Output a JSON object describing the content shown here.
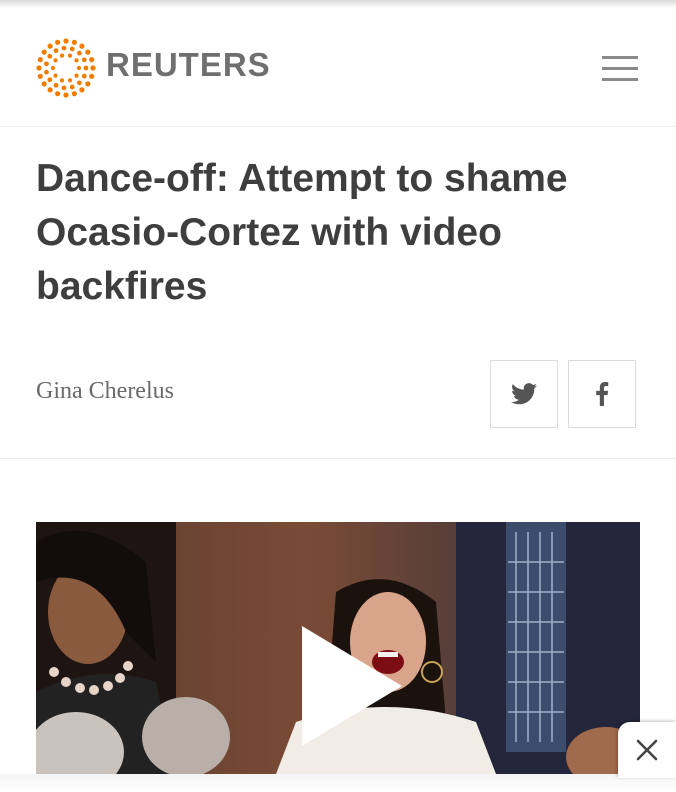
{
  "header": {
    "brand": "REUTERS",
    "brand_color": "#f07d00",
    "logo_icon": "reuters-dot-logo",
    "menu_icon": "hamburger-menu-icon"
  },
  "article": {
    "headline": "Dance-off: Attempt to shame Ocasio-Cortez with video backfires",
    "author": "Gina Cherelus"
  },
  "share": {
    "twitter_icon": "twitter-bird-icon",
    "facebook_icon": "facebook-f-icon"
  },
  "video": {
    "play_icon": "play-icon"
  },
  "ad": {
    "close_icon": "close-x-icon"
  }
}
